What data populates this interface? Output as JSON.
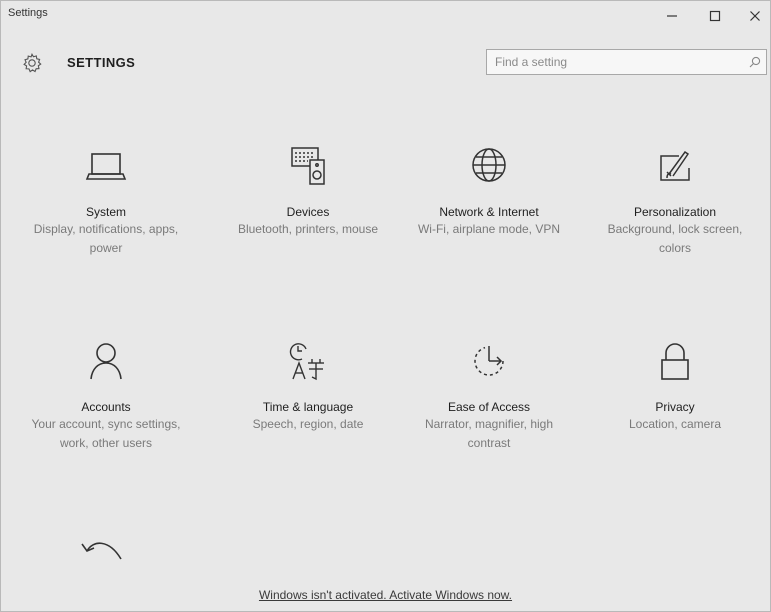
{
  "window": {
    "title": "Settings",
    "controls": [
      "minimize",
      "maximize",
      "close"
    ]
  },
  "header": {
    "title": "SETTINGS",
    "icon": "gear-icon"
  },
  "search": {
    "placeholder": "Find a setting",
    "value": "",
    "icon": "search-icon"
  },
  "tiles": [
    {
      "label": "System",
      "description": "Display, notifications, apps, power",
      "icon": "laptop-icon"
    },
    {
      "label": "Devices",
      "description": "Bluetooth, printers, mouse",
      "icon": "devices-icon"
    },
    {
      "label": "Network & Internet",
      "description": "Wi-Fi, airplane mode, VPN",
      "icon": "globe-icon"
    },
    {
      "label": "Personalization",
      "description": "Background, lock screen, colors",
      "icon": "paintbrush-icon"
    },
    {
      "label": "Accounts",
      "description": "Your account, sync settings, work, other users",
      "icon": "person-icon"
    },
    {
      "label": "Time & language",
      "description": "Speech, region, date",
      "icon": "time-language-icon"
    },
    {
      "label": "Ease of Access",
      "description": "Narrator, magnifier, high contrast",
      "icon": "ease-of-access-icon"
    },
    {
      "label": "Privacy",
      "description": "Location, camera",
      "icon": "lock-icon"
    },
    {
      "label": "",
      "description": "",
      "icon": "undo-arrow-icon"
    }
  ],
  "activation": {
    "text": "Windows isn't activated. Activate Windows now."
  },
  "colors": {
    "background": "#e8e8e8",
    "text": "#1f1f1f",
    "muted": "#7a7a7a",
    "icon_stroke": "#3a3a3a"
  }
}
